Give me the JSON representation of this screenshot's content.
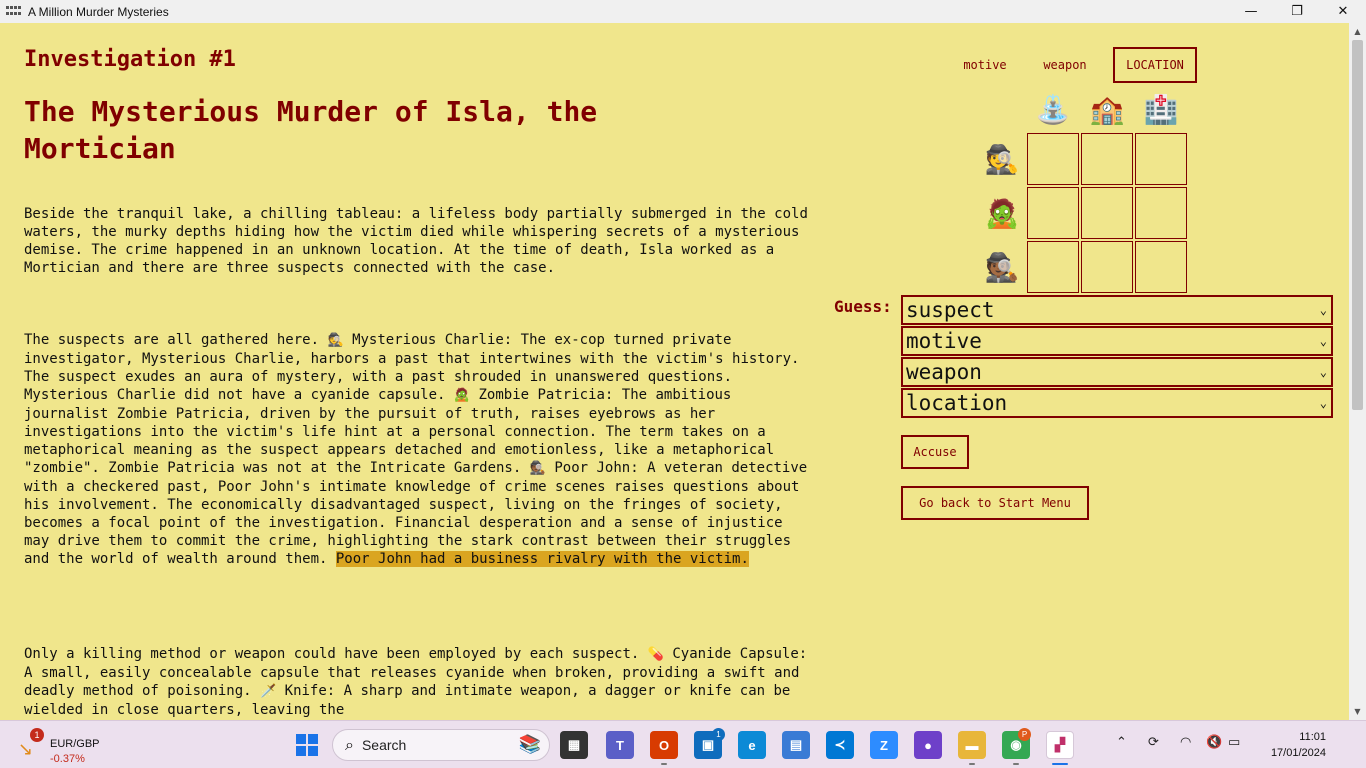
{
  "window": {
    "title": "A Million Murder Mysteries",
    "controls": {
      "minimize": "—",
      "maximize": "❐",
      "close": "✕"
    }
  },
  "page": {
    "investigation_label": "Investigation #1",
    "headline": "The Mysterious Murder of Isla, the Mortician",
    "paragraph1": "Beside the tranquil lake, a chilling tableau: a lifeless body partially submerged in the cold waters, the murky depths hiding how the victim died while whispering secrets of a mysterious demise. The crime happened in an unknown location. At the time of death, Isla worked as a Mortician and there are three suspects connected with the case.",
    "paragraph2": {
      "intro": "The suspects are all gathered here.",
      "charlie_icon": "🕵️",
      "charlie": "Mysterious Charlie: The ex-cop turned private investigator, Mysterious Charlie, harbors a past that intertwines with the victim's history. The suspect exudes an aura of mystery, with a past shrouded in unanswered questions. Mysterious Charlie did not have a cyanide capsule.",
      "patricia_icon": "🧟",
      "patricia": "Zombie Patricia: The ambitious journalist Zombie Patricia, driven by the pursuit of truth, raises eyebrows as her investigations into the victim's life hint at a personal connection. The term takes on a metaphorical meaning as the suspect appears detached and emotionless, like a metaphorical \"zombie\". Zombie Patricia was not at the Intricate Gardens.",
      "john_icon": "🕵🏾",
      "john": "Poor John: A veteran detective with a checkered past, Poor John's intimate knowledge of crime scenes raises questions about his involvement. The economically disadvantaged suspect, living on the fringes of society, becomes a focal point of the investigation. Financial desperation and a sense of injustice may drive them to commit the crime, highlighting the stark contrast between their struggles and the world of wealth around them.",
      "highlight": "Poor John had a business rivalry with the victim."
    },
    "paragraph3": {
      "intro": "Only a killing method or weapon could have been employed by each suspect.",
      "capsule_icon": "💊",
      "capsule": "Cyanide Capsule: A small, easily concealable capsule that releases cyanide when broken, providing a swift and deadly method of poisoning.",
      "knife_icon": "🗡️",
      "knife": "Knife: A sharp and intimate weapon, a dagger or knife can be wielded in close quarters, leaving the"
    }
  },
  "grid": {
    "tabs": [
      {
        "label": "motive",
        "active": false
      },
      {
        "label": "weapon",
        "active": false
      },
      {
        "label": "LOCATION",
        "active": true
      }
    ],
    "column_icons": [
      "⛲",
      "🏫",
      "🏥"
    ],
    "row_icons": [
      "🕵️",
      "🧟",
      "🕵🏾"
    ]
  },
  "guess": {
    "label": "Guess:",
    "selects": [
      "suspect",
      "motive",
      "weapon",
      "location"
    ],
    "accuse_label": "Accuse",
    "back_label": "Go back to Start Menu"
  },
  "taskbar": {
    "fx_badge": "1",
    "fx_pair": "EUR/GBP",
    "fx_change": "-0.37%",
    "search_label": "Search",
    "apps": [
      {
        "name": "file-icon",
        "glyph": "▦",
        "color": "#333333"
      },
      {
        "name": "teams-icon",
        "glyph": "T",
        "color": "#5b5fc7"
      },
      {
        "name": "office-icon",
        "glyph": "O",
        "color": "#d83b01"
      },
      {
        "name": "store-icon",
        "glyph": "▣",
        "color": "#0f6cbd"
      },
      {
        "name": "edge-icon",
        "glyph": "e",
        "color": "#0c8ad6"
      },
      {
        "name": "remote-desktop-icon",
        "glyph": "▤",
        "color": "#3a7bd5"
      },
      {
        "name": "vscode-icon",
        "glyph": "≺",
        "color": "#0078d4"
      },
      {
        "name": "zoom-icon",
        "glyph": "Z",
        "color": "#2d8cff"
      },
      {
        "name": "github-icon",
        "glyph": "●",
        "color": "#6e40c9"
      },
      {
        "name": "explorer-icon",
        "glyph": "▬",
        "color": "#e8b63a"
      },
      {
        "name": "chrome-icon",
        "glyph": "◉",
        "color": "#34a853"
      },
      {
        "name": "active-game-icon",
        "glyph": "▞",
        "color": "#ffffff"
      }
    ],
    "store_badge": "1",
    "chrome_badge": "P",
    "time": "11:01",
    "date": "17/01/2024"
  }
}
